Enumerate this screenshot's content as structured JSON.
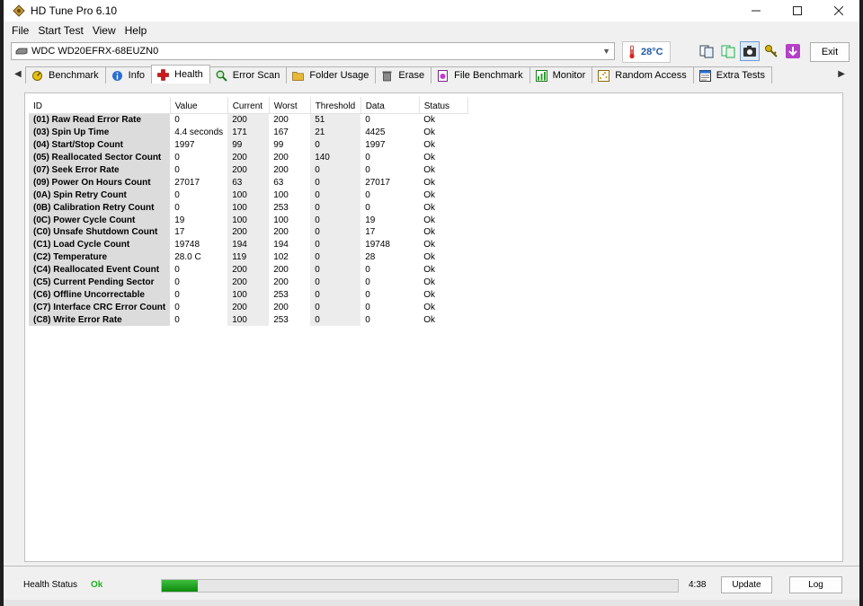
{
  "window": {
    "title": "HD Tune Pro 6.10"
  },
  "menu": {
    "file": "File",
    "start_test": "Start Test",
    "view": "View",
    "help": "Help"
  },
  "drive": {
    "name": "WDC WD20EFRX-68EUZN0",
    "temperature": "28°C"
  },
  "toolbar": {
    "exit_label": "Exit"
  },
  "tabs": [
    {
      "label": "Benchmark",
      "icon": "benchmark-icon"
    },
    {
      "label": "Info",
      "icon": "info-icon"
    },
    {
      "label": "Health",
      "icon": "health-cross-icon",
      "active": true
    },
    {
      "label": "Error Scan",
      "icon": "magnifier-icon"
    },
    {
      "label": "Folder Usage",
      "icon": "folder-icon"
    },
    {
      "label": "Erase",
      "icon": "trash-icon"
    },
    {
      "label": "File Benchmark",
      "icon": "file-benchmark-icon"
    },
    {
      "label": "Monitor",
      "icon": "monitor-chart-icon"
    },
    {
      "label": "Random Access",
      "icon": "random-access-icon"
    },
    {
      "label": "Extra Tests",
      "icon": "extra-tests-icon"
    }
  ],
  "table": {
    "headers": {
      "id": "ID",
      "value": "Value",
      "current": "Current",
      "worst": "Worst",
      "threshold": "Threshold",
      "data": "Data",
      "status": "Status"
    },
    "rows": [
      {
        "id": "(01) Raw Read Error Rate",
        "value": "0",
        "current": "200",
        "worst": "200",
        "threshold": "51",
        "data": "0",
        "status": "Ok"
      },
      {
        "id": "(03) Spin Up Time",
        "value": "4.4 seconds",
        "current": "171",
        "worst": "167",
        "threshold": "21",
        "data": "4425",
        "status": "Ok"
      },
      {
        "id": "(04) Start/Stop Count",
        "value": "1997",
        "current": "99",
        "worst": "99",
        "threshold": "0",
        "data": "1997",
        "status": "Ok"
      },
      {
        "id": "(05) Reallocated Sector Count",
        "value": "0",
        "current": "200",
        "worst": "200",
        "threshold": "140",
        "data": "0",
        "status": "Ok"
      },
      {
        "id": "(07) Seek Error Rate",
        "value": "0",
        "current": "200",
        "worst": "200",
        "threshold": "0",
        "data": "0",
        "status": "Ok"
      },
      {
        "id": "(09) Power On Hours Count",
        "value": "27017",
        "current": "63",
        "worst": "63",
        "threshold": "0",
        "data": "27017",
        "status": "Ok"
      },
      {
        "id": "(0A) Spin Retry Count",
        "value": "0",
        "current": "100",
        "worst": "100",
        "threshold": "0",
        "data": "0",
        "status": "Ok"
      },
      {
        "id": "(0B) Calibration Retry Count",
        "value": "0",
        "current": "100",
        "worst": "253",
        "threshold": "0",
        "data": "0",
        "status": "Ok"
      },
      {
        "id": "(0C) Power Cycle Count",
        "value": "19",
        "current": "100",
        "worst": "100",
        "threshold": "0",
        "data": "19",
        "status": "Ok"
      },
      {
        "id": "(C0) Unsafe Shutdown Count",
        "value": "17",
        "current": "200",
        "worst": "200",
        "threshold": "0",
        "data": "17",
        "status": "Ok"
      },
      {
        "id": "(C1) Load Cycle Count",
        "value": "19748",
        "current": "194",
        "worst": "194",
        "threshold": "0",
        "data": "19748",
        "status": "Ok"
      },
      {
        "id": "(C2) Temperature",
        "value": "28.0 C",
        "current": "119",
        "worst": "102",
        "threshold": "0",
        "data": "28",
        "status": "Ok"
      },
      {
        "id": "(C4) Reallocated Event Count",
        "value": "0",
        "current": "200",
        "worst": "200",
        "threshold": "0",
        "data": "0",
        "status": "Ok"
      },
      {
        "id": "(C5) Current Pending Sector",
        "value": "0",
        "current": "200",
        "worst": "200",
        "threshold": "0",
        "data": "0",
        "status": "Ok"
      },
      {
        "id": "(C6) Offline Uncorrectable",
        "value": "0",
        "current": "100",
        "worst": "253",
        "threshold": "0",
        "data": "0",
        "status": "Ok"
      },
      {
        "id": "(C7) Interface CRC Error Count",
        "value": "0",
        "current": "200",
        "worst": "200",
        "threshold": "0",
        "data": "0",
        "status": "Ok"
      },
      {
        "id": "(C8) Write Error Rate",
        "value": "0",
        "current": "100",
        "worst": "253",
        "threshold": "0",
        "data": "0",
        "status": "Ok"
      }
    ]
  },
  "status": {
    "label": "Health Status",
    "value": "Ok",
    "progress_fraction": 0.07,
    "time": "4:38",
    "update_label": "Update",
    "log_label": "Log"
  },
  "colors": {
    "ok_green": "#24b024",
    "progress_green": "#0c8a0c",
    "temperature_blue": "#1f5aa8"
  }
}
